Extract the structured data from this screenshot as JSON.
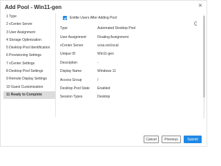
{
  "dialog": {
    "title": "Add Pool - Win11-gen",
    "close_glyph": "×"
  },
  "steps": [
    {
      "label": "1 Type"
    },
    {
      "label": "2 vCenter Server"
    },
    {
      "label": "3 User Assignment"
    },
    {
      "label": "4 Storage Optimization"
    },
    {
      "label": "5 Desktop Pool Identification"
    },
    {
      "label": "6 Provisioning Settings"
    },
    {
      "label": "7 vCenter Settings"
    },
    {
      "label": "8 Desktop Pool Settings"
    },
    {
      "label": "9 Remote Display Settings"
    },
    {
      "label": "10 Guest Customization"
    },
    {
      "label": "11 Ready to Complete",
      "active": true
    }
  ],
  "content": {
    "enable_users_label": "Entitle Users After Adding Pool",
    "enable_users_checked": true,
    "help_glyph": "?",
    "summary": [
      {
        "label": "Type",
        "value": "Automated Desktop Pool"
      },
      {
        "label": "User Assignment",
        "value": "Floating Assignment"
      },
      {
        "label": "vCenter Server",
        "value": "vcsa.red.local"
      },
      {
        "label": "Unique ID",
        "value": "Win11-gen"
      },
      {
        "label": "Description",
        "value": "-"
      },
      {
        "label": "Display Name",
        "value": "Windows 11"
      },
      {
        "label": "Access Group",
        "value": "/"
      },
      {
        "label": "Desktop Pool State",
        "value": "Enabled"
      },
      {
        "label": "Session Types",
        "value": "Desktop"
      }
    ]
  },
  "footer": {
    "cancel_label": "Cancel",
    "previous_label": "Previous",
    "submit_label": "Submit"
  },
  "colors": {
    "accent": "#1e88e5",
    "active_step_bg": "#dcdcdc"
  }
}
